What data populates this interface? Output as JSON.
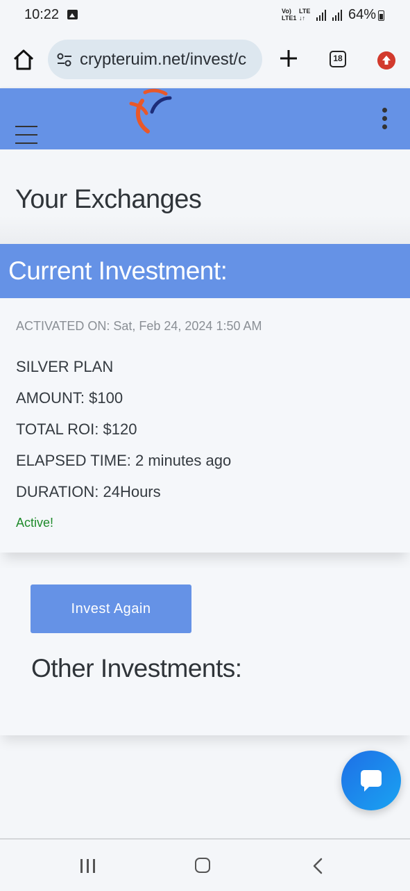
{
  "status_bar": {
    "time": "10:22",
    "volte_line1": "Vo)",
    "volte_line2": "LTE1",
    "lte_line1": "LTE",
    "lte_line2": "↓↑",
    "battery": "64%"
  },
  "browser": {
    "url": "crypteruim.net/invest/c",
    "tab_count": "18"
  },
  "site": {
    "page_title": "Your Exchanges"
  },
  "current_investment": {
    "heading": "Current Investment:",
    "activated": "ACTIVATED ON: Sat, Feb 24, 2024 1:50 AM",
    "plan": "SILVER PLAN",
    "amount": "AMOUNT: $100",
    "total_roi": "TOTAL ROI: $120",
    "elapsed": "ELAPSED TIME: 2 minutes ago",
    "duration": "DURATION: 24Hours",
    "status": "Active!"
  },
  "actions": {
    "invest_again": "Invest Again"
  },
  "other": {
    "heading": "Other Investments:"
  },
  "colors": {
    "brand_blue": "#6592e6",
    "active_green": "#1e8a2a",
    "chat_blue": "#1e6fe6"
  },
  "icons": [
    "gallery-icon",
    "home-icon",
    "site-settings-icon",
    "plus-icon",
    "tabs-icon",
    "upload-icon",
    "hamburger-icon",
    "more-vert-icon",
    "chat-icon",
    "recents-icon",
    "home-nav-icon",
    "back-icon"
  ]
}
